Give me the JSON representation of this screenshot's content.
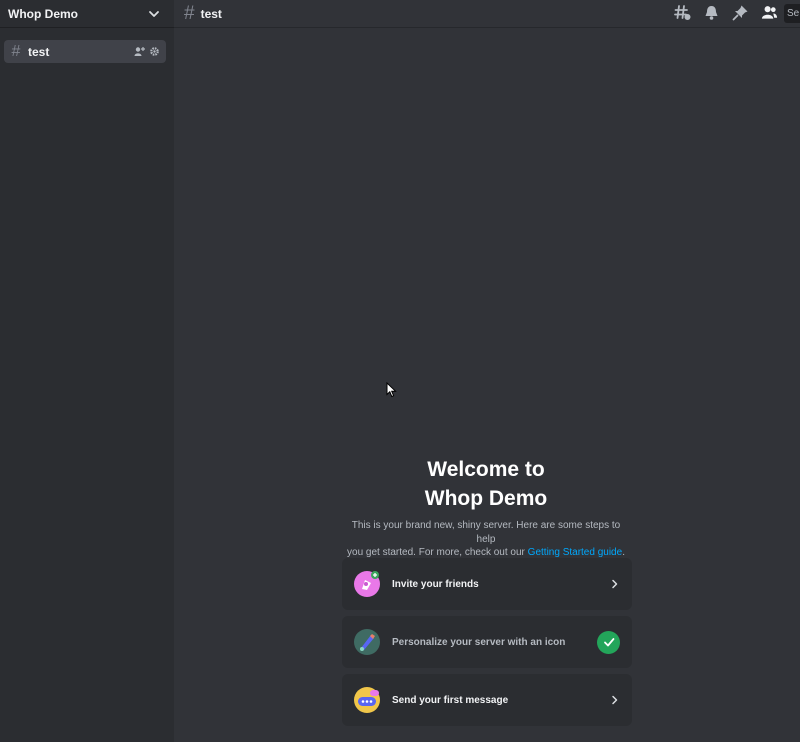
{
  "sidebar": {
    "server_name": "Whop Demo",
    "chevron_icon": "chevron-down-icon",
    "channels": [
      {
        "label": "test",
        "icon": "hashtag-icon",
        "selected": true
      }
    ]
  },
  "header": {
    "channel_name": "test",
    "icons": [
      "threads-icon",
      "bell-icon",
      "pin-icon",
      "members-icon"
    ],
    "search_peek": "Se"
  },
  "welcome": {
    "title_line1": "Welcome to",
    "title_line2": "Whop Demo",
    "desc_line1": "This is your brand new, shiny server. Here are some steps to help",
    "desc_line2_prefix": "you get started. For more, check out our",
    "link_text": "Getting Started guide",
    "desc_suffix": "."
  },
  "cards": [
    {
      "label": "Invite your friends",
      "icon": "invite-friends-icon",
      "status": "arrow"
    },
    {
      "label": "Personalize your server with an icon",
      "icon": "personalize-icon",
      "status": "done"
    },
    {
      "label": "Send your first message",
      "icon": "send-message-icon",
      "status": "arrow"
    }
  ],
  "colors": {
    "sidebar_bg": "#2b2d31",
    "main_bg": "#313338",
    "link": "#00a8fc",
    "success": "#23a55a"
  }
}
